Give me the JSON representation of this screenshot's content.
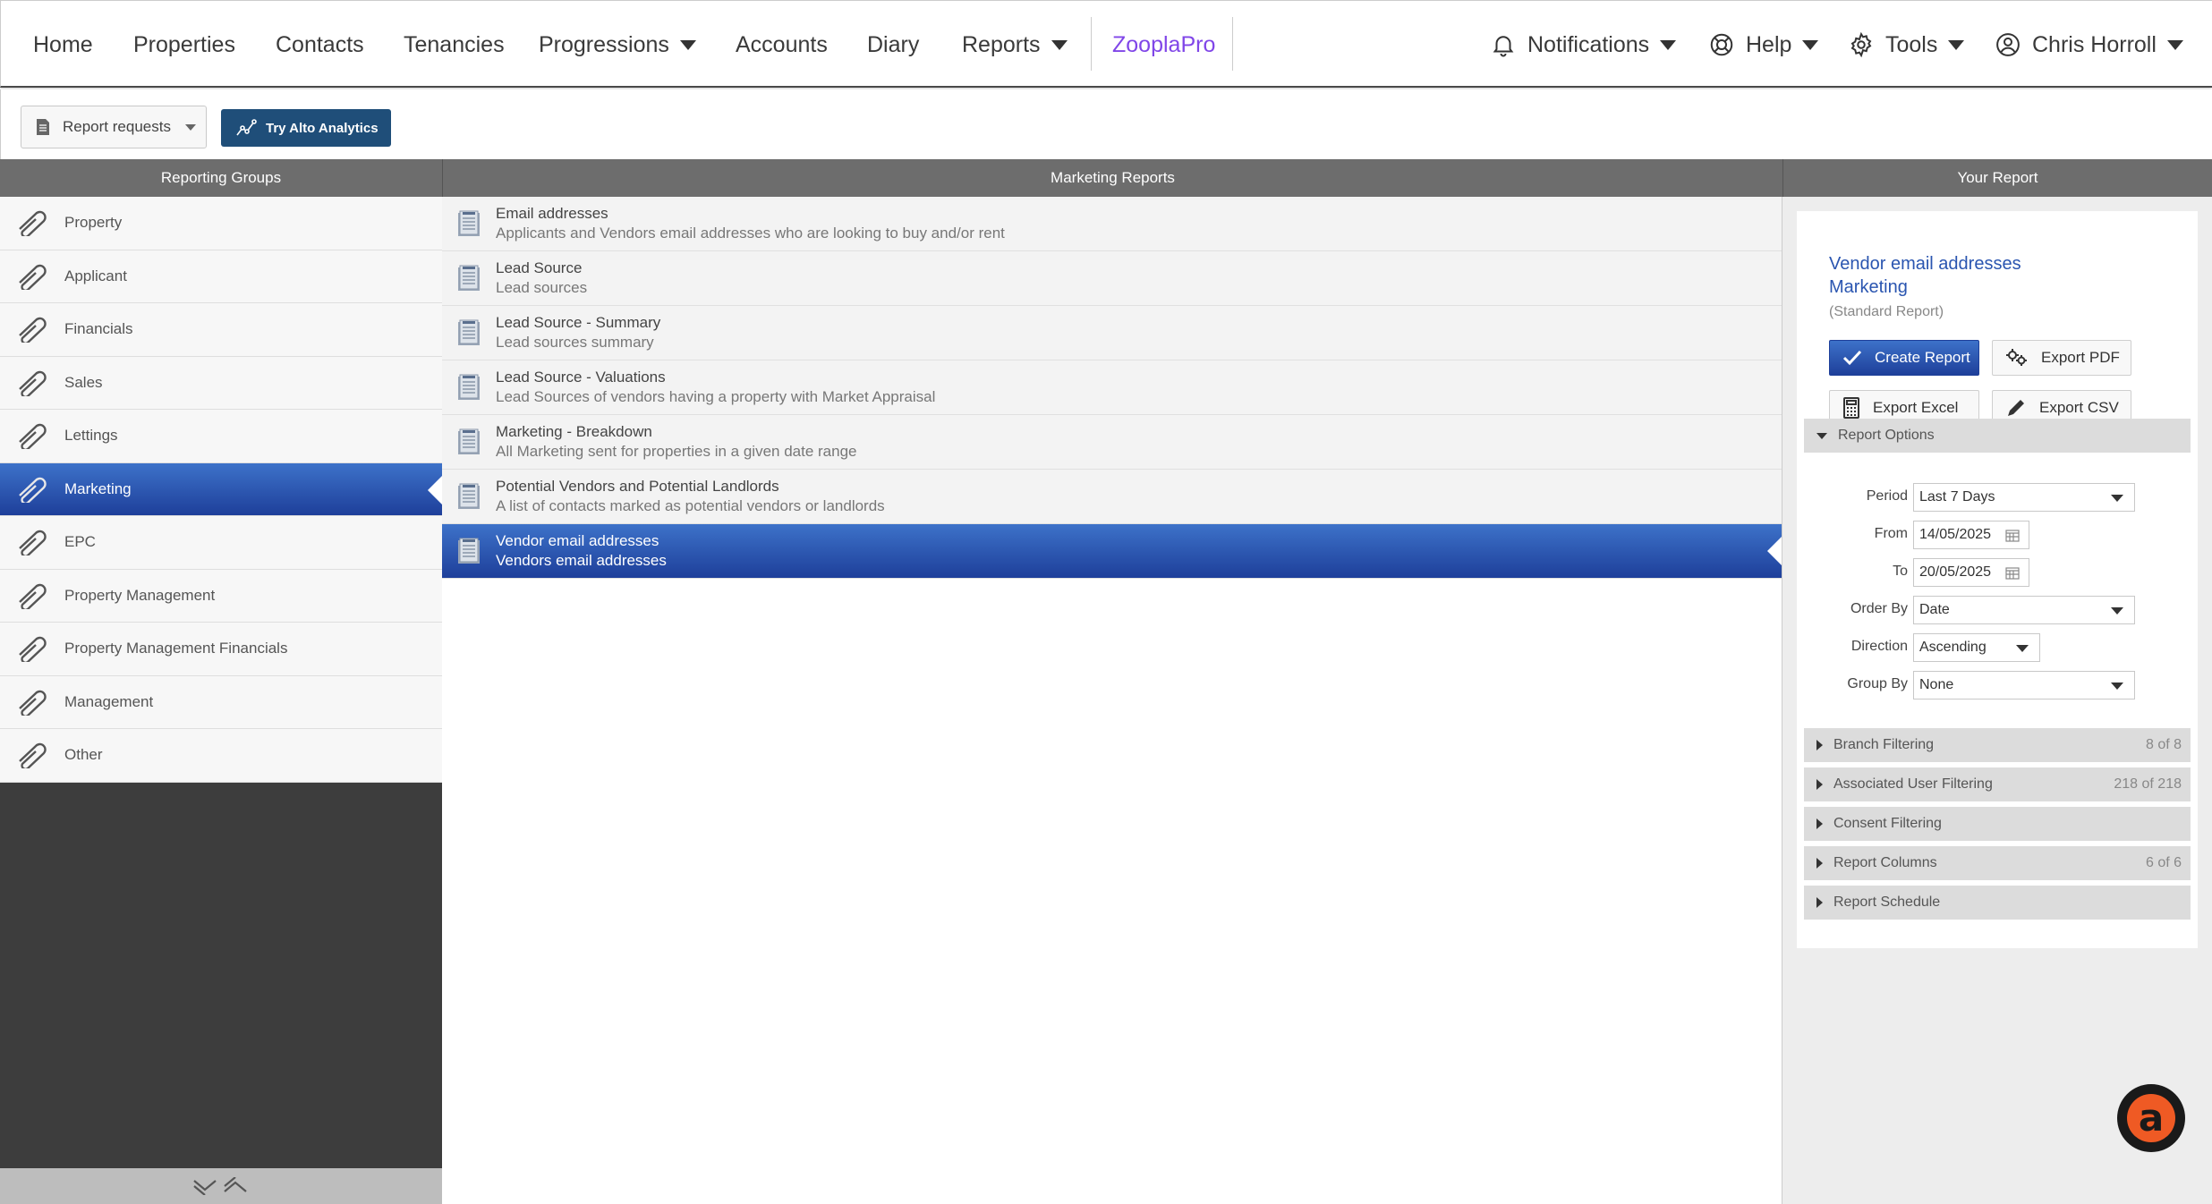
{
  "nav": {
    "home": "Home",
    "properties": "Properties",
    "contacts": "Contacts",
    "tenancies": "Tenancies",
    "progressions": "Progressions",
    "accounts": "Accounts",
    "diary": "Diary",
    "reports": "Reports",
    "zooplapro": "ZooplaPro",
    "notifications": "Notifications",
    "help": "Help",
    "tools": "Tools",
    "user": "Chris Horroll"
  },
  "toolbar": {
    "report_requests": "Report requests",
    "try_alto": "Try Alto Analytics"
  },
  "headers": {
    "groups": "Reporting Groups",
    "reports": "Marketing Reports",
    "your_report": "Your Report"
  },
  "groups": [
    "Property",
    "Applicant",
    "Financials",
    "Sales",
    "Lettings",
    "Marketing",
    "EPC",
    "Property Management",
    "Property Management Financials",
    "Management",
    "Other"
  ],
  "selected_group": "Marketing",
  "reports": [
    {
      "title": "Email addresses",
      "desc": "Applicants and Vendors email addresses who are looking to buy and/or rent"
    },
    {
      "title": "Lead Source",
      "desc": "Lead sources"
    },
    {
      "title": "Lead Source - Summary",
      "desc": "Lead sources summary"
    },
    {
      "title": "Lead Source - Valuations",
      "desc": "Lead Sources of vendors having a property with Market Appraisal"
    },
    {
      "title": "Marketing - Breakdown",
      "desc": "All Marketing sent for properties in a given date range"
    },
    {
      "title": "Potential Vendors and Potential Landlords",
      "desc": "A list of contacts marked as potential vendors or landlords"
    },
    {
      "title": "Vendor email addresses",
      "desc": "Vendors email addresses"
    }
  ],
  "your_report": {
    "name": "Vendor email addresses",
    "group": "Marketing",
    "type": "(Standard Report)",
    "create": "Create Report",
    "export_pdf": "Export PDF",
    "export_excel": "Export Excel",
    "export_csv": "Export CSV",
    "options_title": "Report Options",
    "period_label": "Period",
    "period_value": "Last 7 Days",
    "from_label": "From",
    "from_value": "14/05/2025",
    "to_label": "To",
    "to_value": "20/05/2025",
    "order_label": "Order By",
    "order_value": "Date",
    "direction_label": "Direction",
    "direction_value": "Ascending",
    "group_label": "Group By",
    "group_value": "None",
    "sections": [
      {
        "label": "Branch Filtering",
        "count": "8 of 8"
      },
      {
        "label": "Associated User Filtering",
        "count": "218 of 218"
      },
      {
        "label": "Consent Filtering",
        "count": ""
      },
      {
        "label": "Report Columns",
        "count": "6 of 6"
      },
      {
        "label": "Report Schedule",
        "count": ""
      }
    ]
  },
  "colors": {
    "selected_blue": "#1e3f9a",
    "zoopla_purple": "#8046e8",
    "header_gray": "#6d6d6d"
  }
}
